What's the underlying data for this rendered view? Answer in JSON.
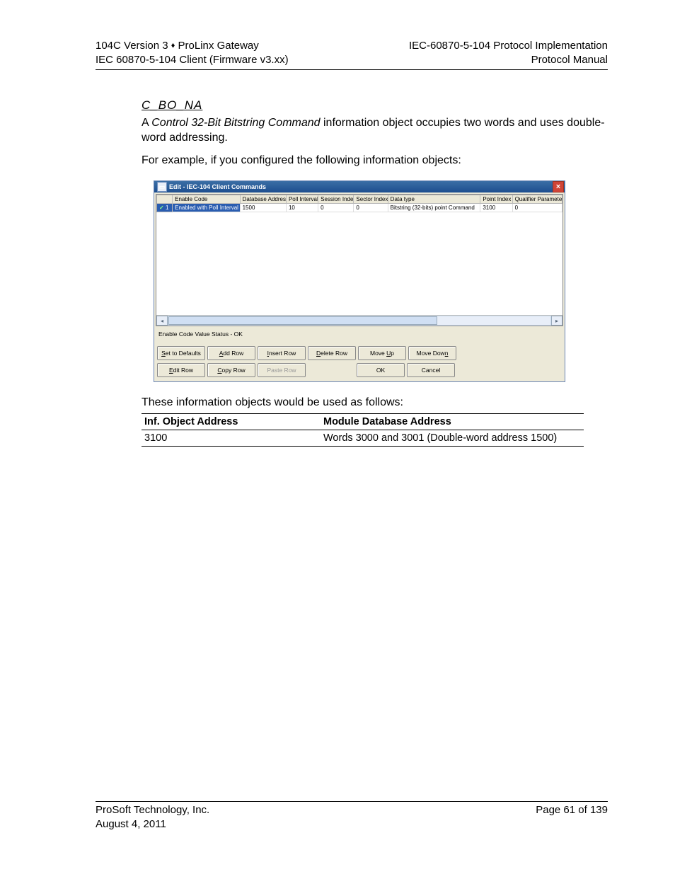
{
  "header": {
    "left1_a": "104C Version 3 ",
    "left1_b": " ProLinx Gateway",
    "left2": "IEC 60870-5-104 Client (Firmware v3.xx)",
    "right1": "IEC-60870-5-104 Protocol Implementation",
    "right2": "Protocol Manual"
  },
  "section": {
    "title": "C_BO_NA",
    "para1_a": "A ",
    "para1_i": "Control 32-Bit Bitstring Command",
    "para1_b": " information object occupies two words and uses double-word addressing.",
    "para2": "For example, if you configured the following information objects:"
  },
  "win": {
    "title": "Edit - IEC-104 Client Commands",
    "headers": [
      "",
      "Enable Code",
      "Database Address",
      "Poll Interval",
      "Session Index",
      "Sector Index",
      "Data type",
      "Point Index",
      "Qualifier Parameter"
    ],
    "row": {
      "idx": "1",
      "enable": "Enabled with Poll Interval",
      "dbaddr": "1500",
      "pollint": "10",
      "sess": "0",
      "sect": "0",
      "dtype": "Bitstring (32-bits) point Command",
      "pidx": "3100",
      "qual": "0"
    },
    "status": "Enable Code Value Status - OK",
    "buttons": {
      "set_defaults": "Set to Defaults",
      "add_row": "Add Row",
      "insert_row": "Insert Row",
      "delete_row": "Delete Row",
      "move_up": "Move Up",
      "move_down": "Move Down",
      "edit_row": "Edit Row",
      "copy_row": "Copy Row",
      "paste_row": "Paste Row",
      "ok": "OK",
      "cancel": "Cancel"
    }
  },
  "post_text": "These information objects would be used as follows:",
  "table": {
    "h1": "Inf. Object Address",
    "h2": "Module Database Address",
    "r1c1": "3100",
    "r1c2": "Words 3000 and 3001 (Double-word address 1500)"
  },
  "footer": {
    "left1": "ProSoft Technology, Inc.",
    "left2": "August 4, 2011",
    "right1": "Page 61 of 139"
  }
}
